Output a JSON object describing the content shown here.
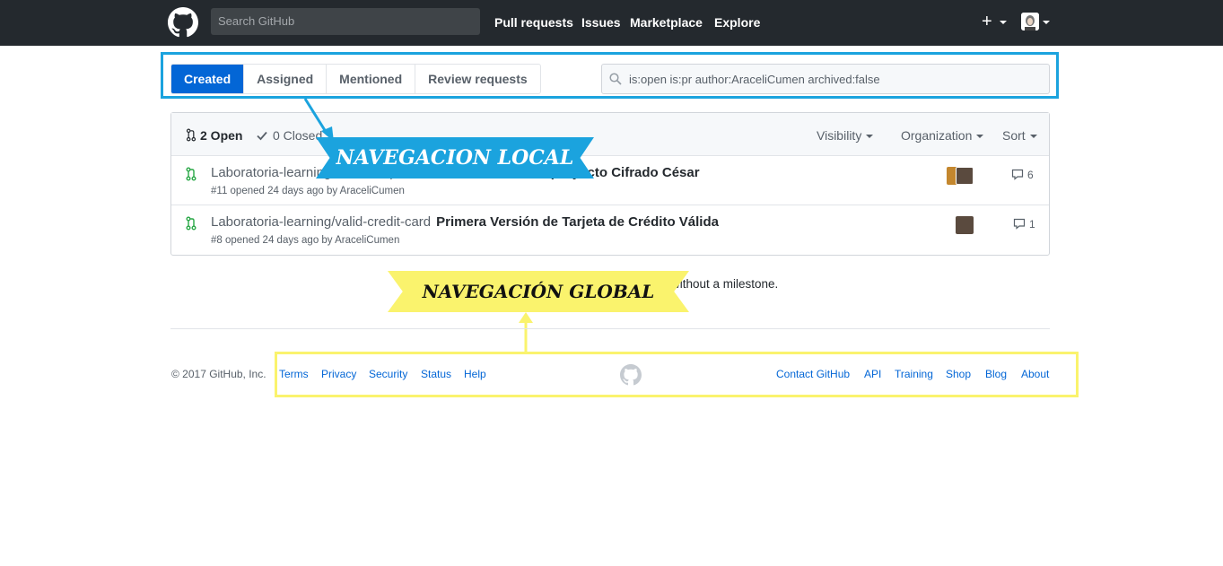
{
  "header": {
    "search_placeholder": "Search GitHub",
    "nav": [
      "Pull requests",
      "Issues",
      "Marketplace",
      "Explore"
    ],
    "plus": "+"
  },
  "subnav": {
    "tabs": [
      "Created",
      "Assigned",
      "Mentioned",
      "Review requests"
    ],
    "active_tab": "Created",
    "query": "is:open is:pr author:AraceliCumen archived:false"
  },
  "list": {
    "open_label": "2 Open",
    "closed_label": "0 Closed",
    "filters": [
      "Visibility",
      "Organization",
      "Sort"
    ],
    "items": [
      {
        "repo": "Laboratoria-learning/caesar-cipher",
        "title": "Primera versión del proyecto Cifrado César",
        "meta": "#11 opened 24 days ago by AraceliCumen",
        "comments": "6"
      },
      {
        "repo": "Laboratoria-learning/valid-credit-card",
        "title": "Primera Versión de Tarjeta de Crédito Válida",
        "meta": "#8 opened 24 days ago by AraceliCumen",
        "comments": "1"
      }
    ]
  },
  "annotations": {
    "local": "NAVEGACION LOCAL",
    "global": "NAVEGACIÓN GLOBAL",
    "local_color": "#1ba3de",
    "global_color": "#faf36d"
  },
  "hint": "without a milestone.",
  "footer": {
    "copyright": "© 2017 GitHub, Inc.",
    "left_links": [
      "Terms",
      "Privacy",
      "Security",
      "Status",
      "Help"
    ],
    "right_links": [
      "Contact GitHub",
      "API",
      "Training",
      "Shop",
      "Blog",
      "About"
    ]
  },
  "colors": {
    "header_bg": "#24292e",
    "primary": "#0366d6",
    "pr_open": "#28a745"
  }
}
